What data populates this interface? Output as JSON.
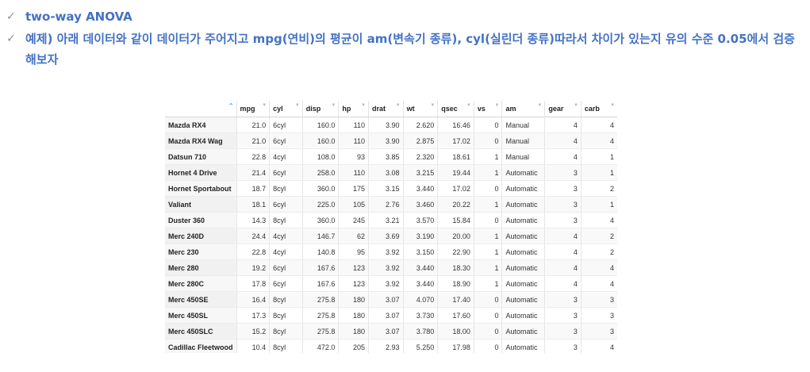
{
  "bullets": [
    {
      "check": "✓",
      "text": "two-way ANOVA"
    },
    {
      "check": "✓",
      "text": "예제) 아래 데이터와 같이 데이터가 주어지고 mpg(연비)의 평균이 am(변속기 종류),  cyl(실린더 종류)따라서 차이가 있는지 유의 수준 0.05에서 검증해보자"
    }
  ],
  "table": {
    "headers": [
      "",
      "mpg",
      "cyl",
      "disp",
      "hp",
      "drat",
      "wt",
      "qsec",
      "vs",
      "am",
      "gear",
      "carb"
    ],
    "rows": [
      [
        "Mazda RX4",
        "21.0",
        "6cyl",
        "160.0",
        "110",
        "3.90",
        "2.620",
        "16.46",
        "0",
        "Manual",
        "4",
        "4"
      ],
      [
        "Mazda RX4 Wag",
        "21.0",
        "6cyl",
        "160.0",
        "110",
        "3.90",
        "2.875",
        "17.02",
        "0",
        "Manual",
        "4",
        "4"
      ],
      [
        "Datsun 710",
        "22.8",
        "4cyl",
        "108.0",
        "93",
        "3.85",
        "2.320",
        "18.61",
        "1",
        "Manual",
        "4",
        "1"
      ],
      [
        "Hornet 4 Drive",
        "21.4",
        "6cyl",
        "258.0",
        "110",
        "3.08",
        "3.215",
        "19.44",
        "1",
        "Automatic",
        "3",
        "1"
      ],
      [
        "Hornet Sportabout",
        "18.7",
        "8cyl",
        "360.0",
        "175",
        "3.15",
        "3.440",
        "17.02",
        "0",
        "Automatic",
        "3",
        "2"
      ],
      [
        "Valiant",
        "18.1",
        "6cyl",
        "225.0",
        "105",
        "2.76",
        "3.460",
        "20.22",
        "1",
        "Automatic",
        "3",
        "1"
      ],
      [
        "Duster 360",
        "14.3",
        "8cyl",
        "360.0",
        "245",
        "3.21",
        "3.570",
        "15.84",
        "0",
        "Automatic",
        "3",
        "4"
      ],
      [
        "Merc 240D",
        "24.4",
        "4cyl",
        "146.7",
        "62",
        "3.69",
        "3.190",
        "20.00",
        "1",
        "Automatic",
        "4",
        "2"
      ],
      [
        "Merc 230",
        "22.8",
        "4cyl",
        "140.8",
        "95",
        "3.92",
        "3.150",
        "22.90",
        "1",
        "Automatic",
        "4",
        "2"
      ],
      [
        "Merc 280",
        "19.2",
        "6cyl",
        "167.6",
        "123",
        "3.92",
        "3.440",
        "18.30",
        "1",
        "Automatic",
        "4",
        "4"
      ],
      [
        "Merc 280C",
        "17.8",
        "6cyl",
        "167.6",
        "123",
        "3.92",
        "3.440",
        "18.90",
        "1",
        "Automatic",
        "4",
        "4"
      ],
      [
        "Merc 450SE",
        "16.4",
        "8cyl",
        "275.8",
        "180",
        "3.07",
        "4.070",
        "17.40",
        "0",
        "Automatic",
        "3",
        "3"
      ],
      [
        "Merc 450SL",
        "17.3",
        "8cyl",
        "275.8",
        "180",
        "3.07",
        "3.730",
        "17.60",
        "0",
        "Automatic",
        "3",
        "3"
      ],
      [
        "Merc 450SLC",
        "15.2",
        "8cyl",
        "275.8",
        "180",
        "3.07",
        "3.780",
        "18.00",
        "0",
        "Automatic",
        "3",
        "3"
      ],
      [
        "Cadillac Fleetwood",
        "10.4",
        "8cyl",
        "472.0",
        "205",
        "2.93",
        "5.250",
        "17.98",
        "0",
        "Automatic",
        "3",
        "4"
      ]
    ]
  }
}
